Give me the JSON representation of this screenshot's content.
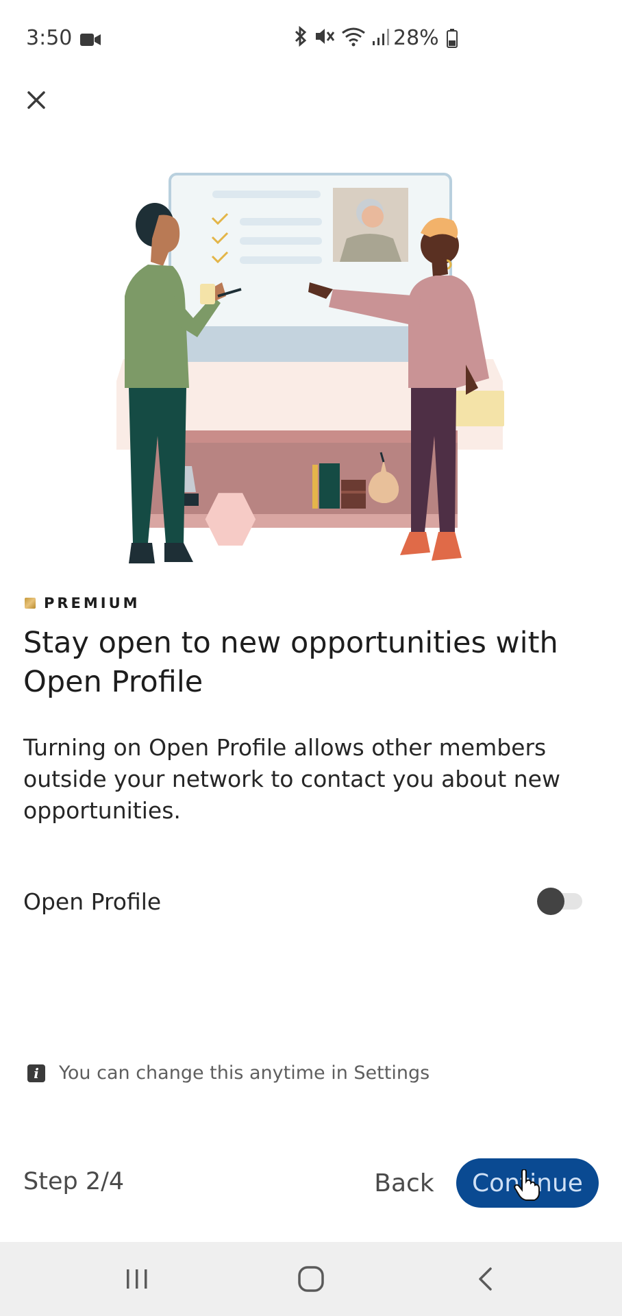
{
  "status_bar": {
    "time": "3:50",
    "battery_percent": "28%",
    "icons": [
      "video-icon",
      "bluetooth-icon",
      "mute-icon",
      "wifi-icon",
      "signal-icon",
      "battery-icon"
    ]
  },
  "header": {
    "close_icon": "close-icon"
  },
  "content": {
    "premium_label": "PREMIUM",
    "headline": "Stay open to new opportunities with Open Profile",
    "description": "Turning on Open Profile allows other members outside your network to contact you about new opportunities.",
    "toggle_label": "Open Profile",
    "toggle_on": false,
    "info_text": "You can change this anytime in Settings"
  },
  "footer": {
    "step": "Step 2/4",
    "back_label": "Back",
    "continue_label": "Continue"
  },
  "nav_bar": {
    "items": [
      "recent-apps-icon",
      "home-icon",
      "back-arrow-icon"
    ]
  },
  "colors": {
    "accent": "#0a4a92",
    "premium_gold": "#c69a3c",
    "toggle_knob": "#434343",
    "nav_bg": "#efefef"
  }
}
